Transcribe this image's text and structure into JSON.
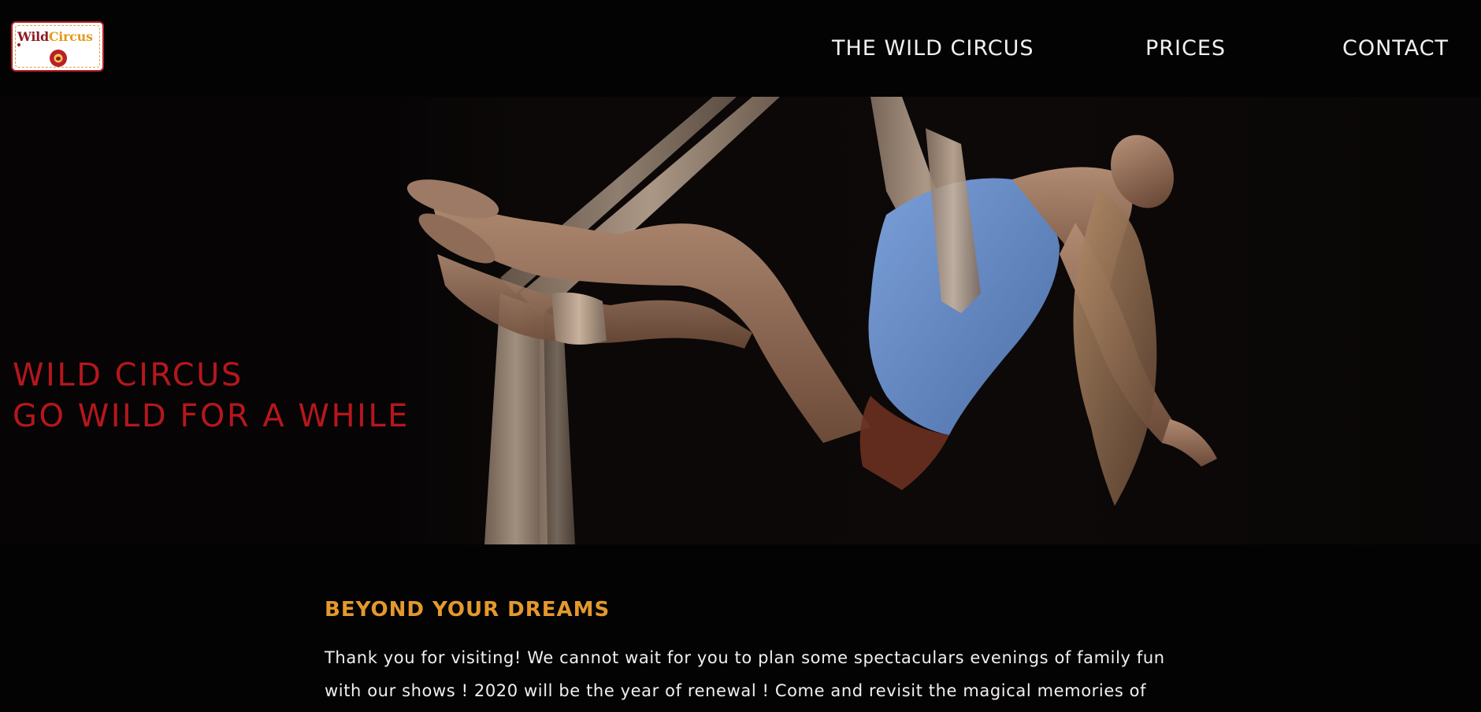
{
  "header": {
    "logo": {
      "word_1": "Wild",
      "word_2": "Circus"
    },
    "nav": [
      {
        "label": "THE WILD CIRCUS"
      },
      {
        "label": "PRICES"
      },
      {
        "label": "CONTACT"
      }
    ]
  },
  "hero": {
    "title_line_1": "WILD CIRCUS",
    "title_line_2": "GO WILD FOR A WHILE",
    "image": "aerial-silk-performer"
  },
  "intro": {
    "heading": "BEYOND YOUR DREAMS",
    "text": "Thank you for visiting! We cannot wait for you to plan some spectaculars evenings of family fun with our shows ! 2020 will be the year of renewal ! Come and revisit the magical memories of"
  },
  "colors": {
    "background": "#040304",
    "nav_text": "#f3f0ee",
    "hero_title": "#b5171c",
    "heading_accent": "#e4992d",
    "body_text": "#f2efec",
    "logo_red": "#8e1a1f",
    "logo_orange": "#e49a1c"
  }
}
